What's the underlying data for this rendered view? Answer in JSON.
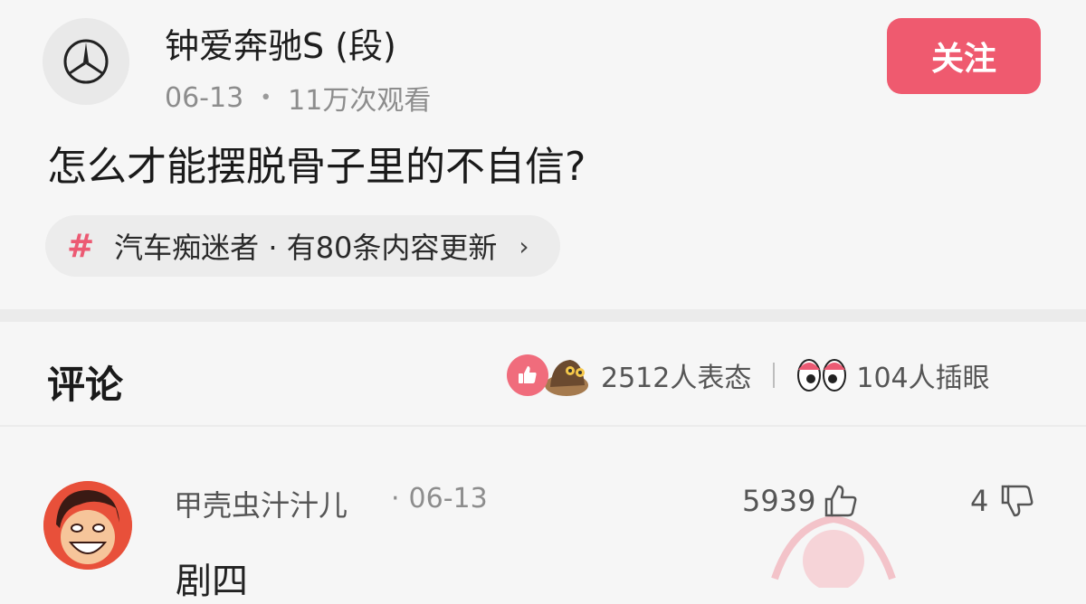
{
  "post": {
    "author_name": "钟爱奔驰S (段)",
    "date": "06-13",
    "views": "11万次观看",
    "follow_label": "关注",
    "question": "怎么才能摆脱骨子里的不自信?",
    "topic": {
      "icon": "hash-icon",
      "text": "汽车痴迷者 · 有80条内容更新"
    }
  },
  "comments_header": {
    "title": "评论",
    "reactions_count": "2512人表态",
    "peek_count": "104人插眼"
  },
  "comment": {
    "user": "甲壳虫汁汁儿",
    "date": "06-13",
    "likes": "5939",
    "dislikes": "4",
    "text": "剧四"
  },
  "colors": {
    "accent": "#ef5a6f",
    "hash": "#ec5a73",
    "background": "#f6f6f6"
  }
}
